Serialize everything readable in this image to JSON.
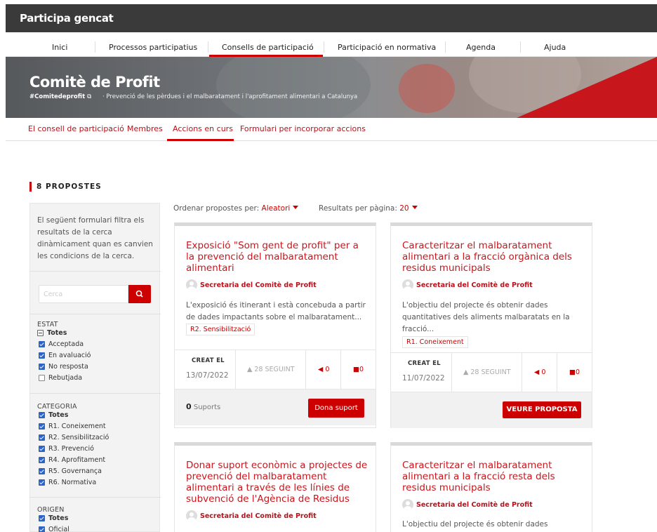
{
  "app": {
    "title": "Participa gencat"
  },
  "nav": {
    "items": [
      "Inici",
      "Processos participatius",
      "Consells de participació",
      "Participació en normativa",
      "Agenda",
      "Ajuda"
    ],
    "active_index": 2
  },
  "hero": {
    "title": "Comitè de Profit",
    "hashtag": "#Comitedeprofit",
    "hashtag_icon": "external-link-icon",
    "subtitle": "·  Prevenció de les pèrdues i el malbaratament i l'aprofitament alimentari a Catalunya"
  },
  "subnav": {
    "items": [
      "El consell de participació",
      "Membres",
      "Accions en curs",
      "Formulari per incorporar accions"
    ],
    "active_index": 2
  },
  "results": {
    "count_label": "8 PROPOSTES"
  },
  "filters": {
    "intro": "El següent formulari filtra els resultats de la cerca dinàmicament quan es canvien les condicions de la cerca.",
    "search_placeholder": "Cerca",
    "search_icon": "search-icon",
    "estat": {
      "title": "ESTAT",
      "all_label": "Totes",
      "options": [
        {
          "label": "Acceptada",
          "checked": true
        },
        {
          "label": "En avaluació",
          "checked": true
        },
        {
          "label": "No resposta",
          "checked": true
        },
        {
          "label": "Rebutjada",
          "checked": false
        }
      ]
    },
    "categoria": {
      "title": "CATEGORIA",
      "all_label": "Totes",
      "options": [
        {
          "label": "R1. Coneixement",
          "checked": true
        },
        {
          "label": "R2. Sensibilització",
          "checked": true
        },
        {
          "label": "R3. Prevenció",
          "checked": true
        },
        {
          "label": "R4. Aprofitament",
          "checked": true
        },
        {
          "label": "R5. Governança",
          "checked": true
        },
        {
          "label": "R6. Normativa",
          "checked": true
        }
      ]
    },
    "origen": {
      "title": "ORIGEN",
      "all_label": "Totes",
      "options": [
        {
          "label": "Oficial",
          "checked": true
        }
      ]
    }
  },
  "sorting": {
    "order_label": "Ordenar propostes per:",
    "order_value": "Aleatori",
    "per_page_label": "Resultats per pàgina:",
    "per_page_value": "20"
  },
  "cards": [
    {
      "title": "Exposició \"Som gent de profit\" per a la prevenció del malbaratament alimentari",
      "author": "Secretaria del Comitè de Profit",
      "description": "L'exposició és itinerant i està concebuda a partir de dades impactants sobre el malbaratament...",
      "tag": "R2. Sensibilització",
      "created_label": "CREAT EL",
      "created_date": "13/07/2022",
      "following": "28 SEGUINT",
      "endorsements": "0",
      "comments": "0",
      "supports_count": "0",
      "supports_label": "Suports",
      "action_label": "Dona suport"
    },
    {
      "title": "Caracteritzar el malbaratament alimentari a la fracció orgànica dels residus municipals",
      "author": "Secretaria del Comitè de Profit",
      "description": "L'objectiu del projecte és obtenir dades quantitatives dels aliments malbaratats en la fracció...",
      "tag": "R1. Coneixement",
      "created_label": "CREAT EL",
      "created_date": "11/07/2022",
      "following": "28 SEGUINT",
      "endorsements": "0",
      "comments": "0",
      "action_label": "VEURE PROPOSTA"
    },
    {
      "title": "Donar suport econòmic a projectes de prevenció del malbaratament alimentari a través de les línies de subvenció de l'Agència de Residus",
      "author": "Secretaria del Comitè de Profit"
    },
    {
      "title": "Caracteritzar el malbaratament alimentari a la fracció resta dels residus municipals",
      "author": "Secretaria del Comitè de Profit",
      "description": "L'objectiu del projecte és obtenir dades"
    }
  ],
  "colors": {
    "brand_red": "#c00000",
    "topbar": "#3a3a3a",
    "checkbox_blue": "#2a64c8"
  }
}
